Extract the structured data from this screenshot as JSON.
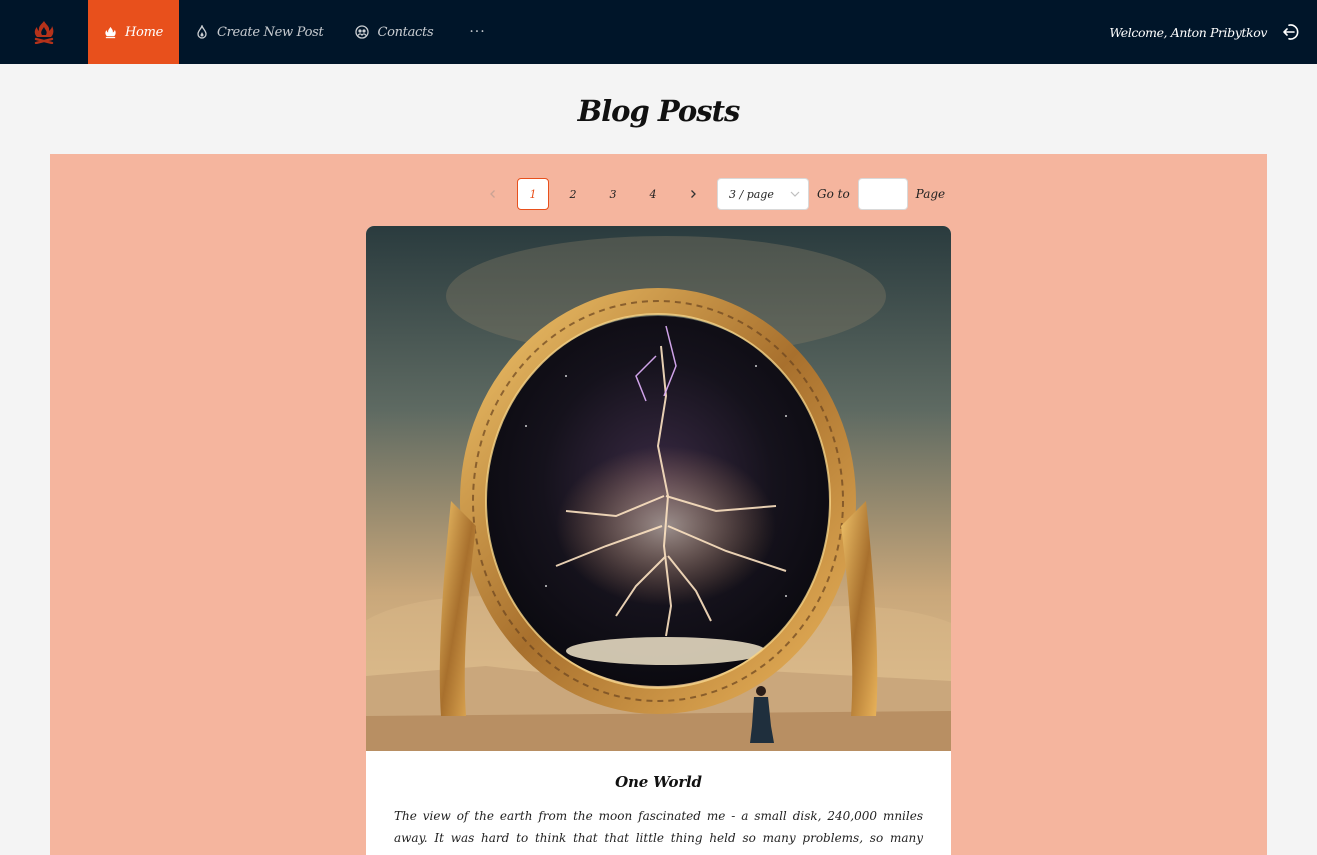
{
  "header": {
    "nav": {
      "home": "Home",
      "create": "Create New Post",
      "contacts": "Contacts",
      "more": "···"
    },
    "welcome": "Welcome, Anton Pribytkov"
  },
  "page": {
    "title": "Blog Posts"
  },
  "pagination": {
    "pages": [
      "1",
      "2",
      "3",
      "4"
    ],
    "current": "1",
    "page_size": "3 / page",
    "goto_label": "Go to",
    "page_label": "Page",
    "goto_value": ""
  },
  "post": {
    "title": "One World",
    "description": "The view of the earth from the moon fascinated me - a small disk, 240,000 mniles away. It was hard to think that that little thing held so many problems, so many frustrations. Raging nationalistic interests, famines, wars, pestilence don't show from that distance."
  },
  "colors": {
    "header_bg": "#001529",
    "accent": "#e8501c",
    "panel_bg": "#f5b59e",
    "page_bg": "#f4f4f4"
  },
  "icons": [
    "logo-icon",
    "home-icon",
    "create-post-icon",
    "contacts-icon",
    "logout-icon",
    "prev-icon",
    "next-icon",
    "chevron-down-icon"
  ]
}
